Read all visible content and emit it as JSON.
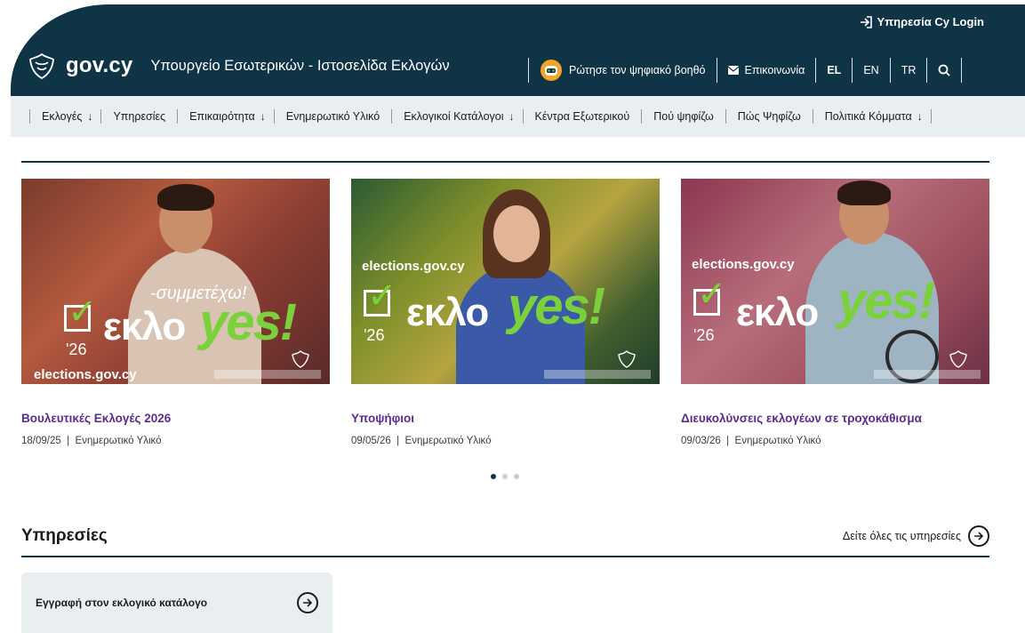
{
  "header": {
    "login_label": "Υπηρεσία Cy Login",
    "brand": "gov.cy",
    "ministry": "Υπουργείο Εσωτερικών - Ιστοσελίδα Εκλογών",
    "assistant_label": "Ρώτησε τον ψηφιακό βοηθό",
    "contact_label": "Επικοινωνία",
    "languages": [
      "EL",
      "EN",
      "TR"
    ],
    "active_language": "EL"
  },
  "nav": {
    "items": [
      {
        "label": "Εκλογές",
        "has_dropdown": true
      },
      {
        "label": "Υπηρεσίες",
        "has_dropdown": false
      },
      {
        "label": "Επικαιρότητα",
        "has_dropdown": true
      },
      {
        "label": "Ενημερωτικό Υλικό",
        "has_dropdown": false
      },
      {
        "label": "Εκλογικοί Κατάλογοι",
        "has_dropdown": true
      },
      {
        "label": "Κέντρα Εξωτερικού",
        "has_dropdown": false
      },
      {
        "label": "Πού ψηφίζω",
        "has_dropdown": false
      },
      {
        "label": "Πώς Ψηφίζω",
        "has_dropdown": false
      },
      {
        "label": "Πολιτικά Κόμματα",
        "has_dropdown": true
      }
    ]
  },
  "cards": [
    {
      "title": "Βουλευτικές Εκλογές 2026",
      "date": "18/09/25",
      "category": "Ενημερωτικό Υλικό",
      "poster": {
        "site": "elections.gov.cy",
        "slogan": "-συμμετέχω!",
        "word_a": "εκλο",
        "word_b": "yes!",
        "year": "'26"
      }
    },
    {
      "title": "Υποψήφιοι",
      "date": "09/05/26",
      "category": "Ενημερωτικό Υλικό",
      "poster": {
        "site": "elections.gov.cy",
        "word_a": "εκλο",
        "word_b": "yes!",
        "year": "'26"
      }
    },
    {
      "title": "Διευκολύνσεις εκλογέων σε τροχοκάθισμα",
      "date": "09/03/26",
      "category": "Ενημερωτικό Υλικό",
      "poster": {
        "site": "elections.gov.cy",
        "word_a": "εκλο",
        "word_b": "yes!",
        "year": "'26"
      }
    }
  ],
  "meta_separator": "|",
  "pager": {
    "count": 3,
    "active": 0
  },
  "services": {
    "title": "Υπηρεσίες",
    "see_all_label": "Δείτε όλες τις υπηρεσίες",
    "items": [
      {
        "label": "Εγγραφή στον εκλογικό κατάλογο"
      }
    ]
  },
  "colors": {
    "header_bg": "#0f3446",
    "link": "#5a2d91",
    "nav_bg": "#e9eef0",
    "accent_green": "#7bd13b"
  }
}
